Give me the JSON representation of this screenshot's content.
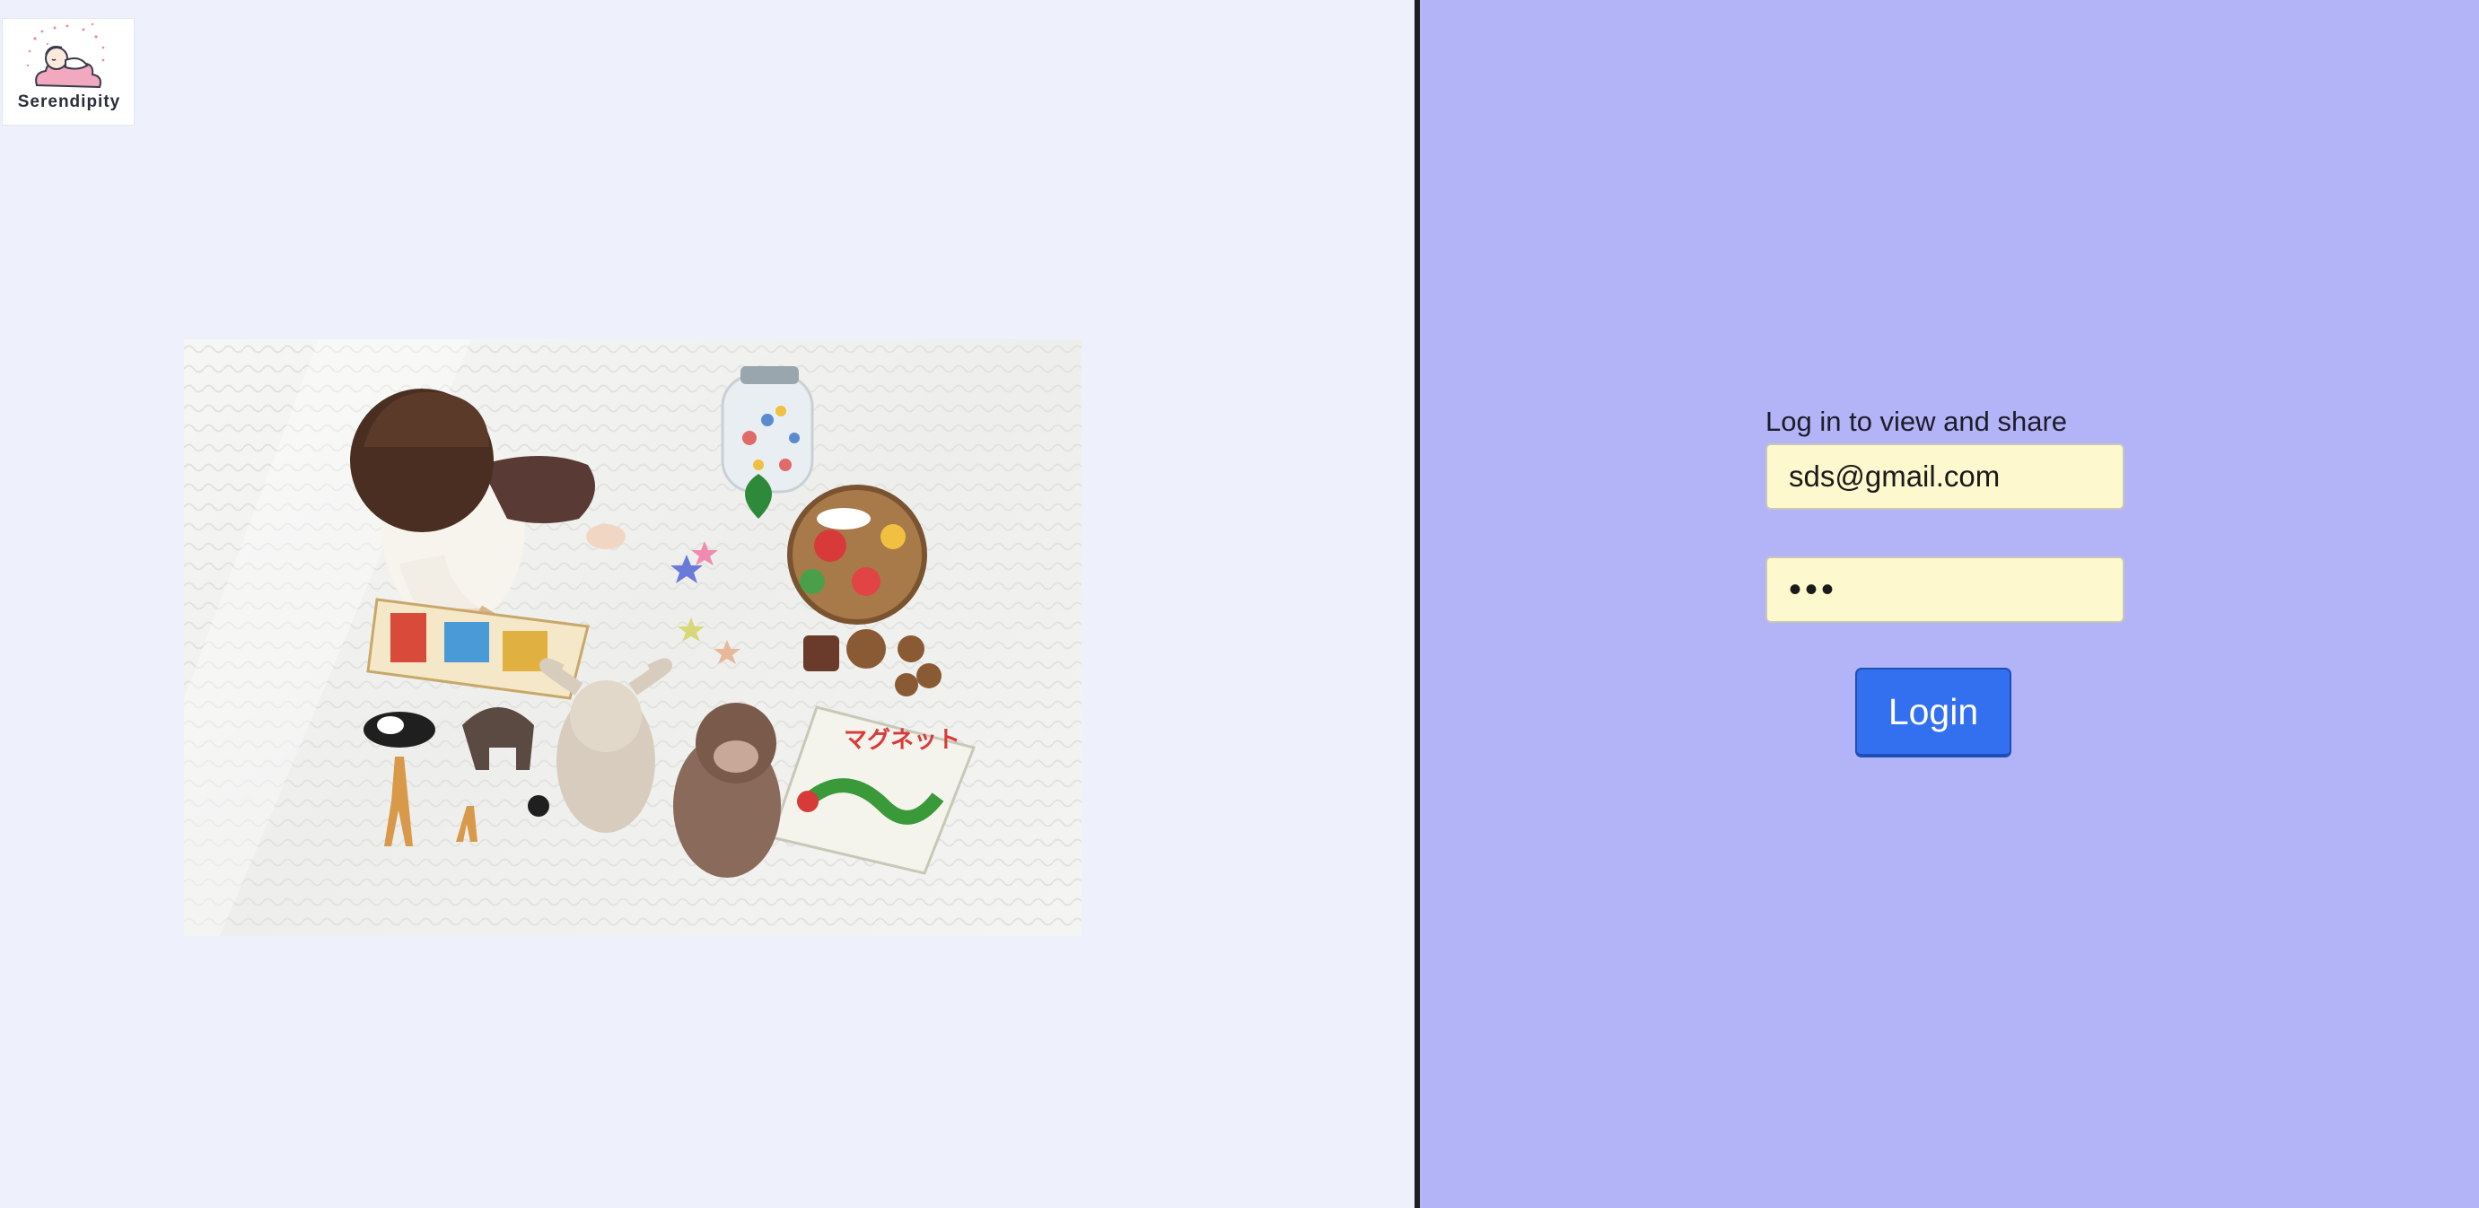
{
  "brand": {
    "name": "Serendipity",
    "logo_icon": "sleeping-baby-on-cloud-logo",
    "logo_cloud_color": "#f2a9c0"
  },
  "hero": {
    "alt": "Baby playing with toys on a white blanket",
    "icon": "baby-with-toys-photo"
  },
  "login": {
    "heading": "Log in to view and share",
    "email_value": "sds@gmail.com",
    "password_value": "abc",
    "button_label": "Login"
  },
  "colors": {
    "left_background": "#eef1fb",
    "right_background": "#b3b3f8",
    "divider": "#1f1f1f",
    "input_background": "#fdf8cd",
    "button_background": "#3370f0"
  }
}
